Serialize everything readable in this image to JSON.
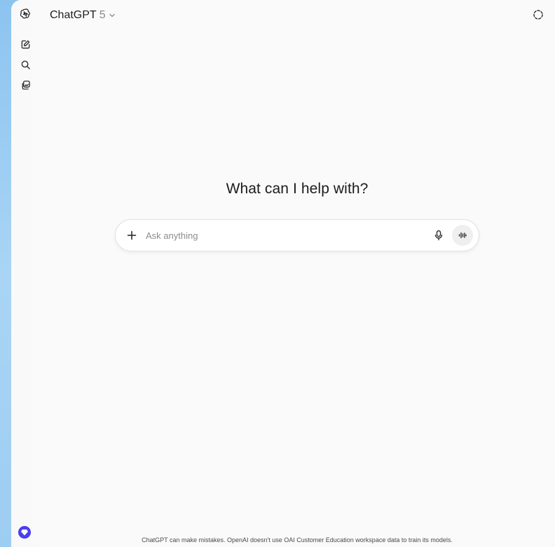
{
  "header": {
    "model_name": "ChatGPT",
    "model_version": "5"
  },
  "sidebar": {
    "items": [
      {
        "icon": "new-chat-icon"
      },
      {
        "icon": "search-icon"
      },
      {
        "icon": "library-icon"
      }
    ]
  },
  "main": {
    "headline": "What can I help with?"
  },
  "composer": {
    "placeholder": "Ask anything",
    "value": ""
  },
  "footer": {
    "disclaimer": "ChatGPT can make mistakes. OpenAI doesn't use OAI Customer Education workspace data to train its models."
  },
  "colors": {
    "accent": "#4a3ff0",
    "background": "#fafafa"
  }
}
